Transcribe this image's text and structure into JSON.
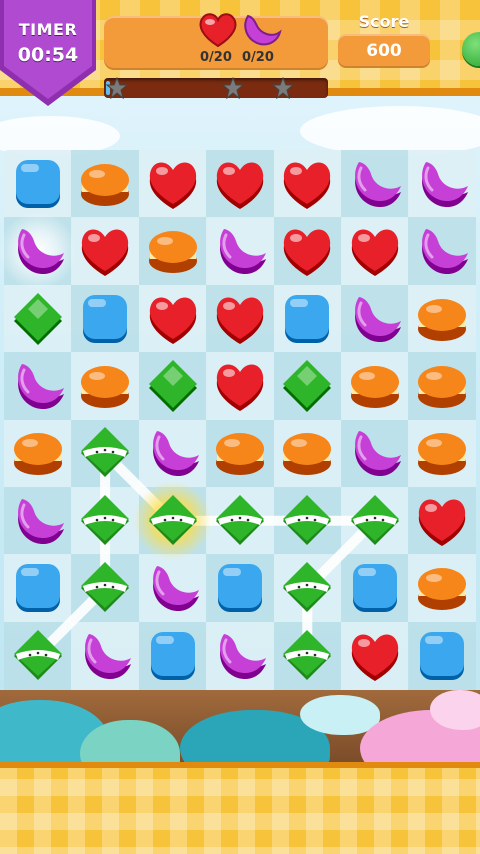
{
  "hud": {
    "timer_label": "TIMER",
    "timer_value": "00:54",
    "goals": [
      {
        "candy": "heart",
        "count": "0/20"
      },
      {
        "candy": "moon",
        "count": "0/20"
      }
    ],
    "progress_fraction": 0.02,
    "progress_stars": 3,
    "score_label": "Score",
    "score_value": "600"
  },
  "colors": {
    "heart": "#e8202a",
    "moon": "#c63fd6",
    "square": "#3aa7ee",
    "macaron": "#f7861a",
    "diamond": "#2fb52a",
    "stripe": "#2fb52a",
    "timer_banner": "#a03cc0"
  },
  "board": {
    "rows": 8,
    "cols": 7,
    "grid": [
      [
        "square",
        "macaron",
        "heart",
        "heart",
        "heart",
        "moon",
        "moon"
      ],
      [
        "moon",
        "heart",
        "macaron",
        "moon",
        "heart",
        "heart",
        "moon"
      ],
      [
        "diamond",
        "square",
        "heart",
        "heart",
        "square",
        "moon",
        "macaron"
      ],
      [
        "moon",
        "macaron",
        "diamond",
        "heart",
        "diamond",
        "macaron",
        "macaron"
      ],
      [
        "macaron",
        "stripe",
        "moon",
        "macaron",
        "macaron",
        "moon",
        "macaron"
      ],
      [
        "moon",
        "stripe",
        "stripe",
        "stripe",
        "stripe",
        "stripe",
        "heart"
      ],
      [
        "square",
        "stripe",
        "moon",
        "square",
        "stripe",
        "square",
        "macaron"
      ],
      [
        "stripe",
        "moon",
        "square",
        "moon",
        "stripe",
        "heart",
        "square"
      ]
    ],
    "selected_path": [
      [
        7,
        0
      ],
      [
        6,
        1
      ],
      [
        5,
        1
      ],
      [
        4,
        1
      ],
      [
        5,
        2
      ],
      [
        5,
        3
      ],
      [
        5,
        4
      ],
      [
        5,
        5
      ],
      [
        6,
        4
      ],
      [
        7,
        4
      ]
    ],
    "glow_cells": [
      [
        1,
        0
      ],
      [
        5,
        2
      ]
    ]
  }
}
